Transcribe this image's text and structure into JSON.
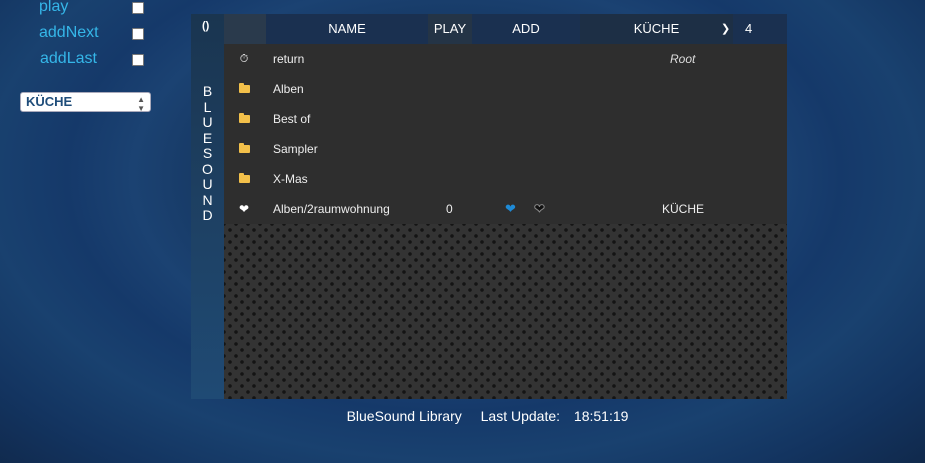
{
  "controls": {
    "options": [
      {
        "label": "play",
        "checked": false
      },
      {
        "label": "addNext",
        "checked": false
      },
      {
        "label": "addLast",
        "checked": false
      }
    ],
    "room_select": "KÜCHE"
  },
  "sidebar": {
    "refresh_icon": "refresh-icon",
    "vertical_label": [
      "B",
      "L",
      "U",
      "E",
      "S",
      "O",
      "U",
      "N",
      "D"
    ]
  },
  "table": {
    "headers": {
      "name": "NAME",
      "play": "PLAY",
      "add": "ADD",
      "room": "KÜCHE",
      "count": "4"
    },
    "rows": [
      {
        "icon": "return-icon",
        "name": "return",
        "extra": "Root"
      },
      {
        "icon": "folder-icon",
        "name": "Alben"
      },
      {
        "icon": "folder-icon",
        "name": "Best of"
      },
      {
        "icon": "folder-icon",
        "name": "Sampler"
      },
      {
        "icon": "folder-icon",
        "name": "X-Mas"
      }
    ],
    "favorite": {
      "name": "Alben/2raumwohnung",
      "count": "0",
      "room": "KÜCHE"
    }
  },
  "footer": {
    "library": "BlueSound Library",
    "update_label": "Last Update:",
    "time": "18:51:19"
  },
  "colors": {
    "accent": "#35b6e8",
    "folder": "#f2c04a",
    "heart_blue": "#1e8ad6"
  }
}
